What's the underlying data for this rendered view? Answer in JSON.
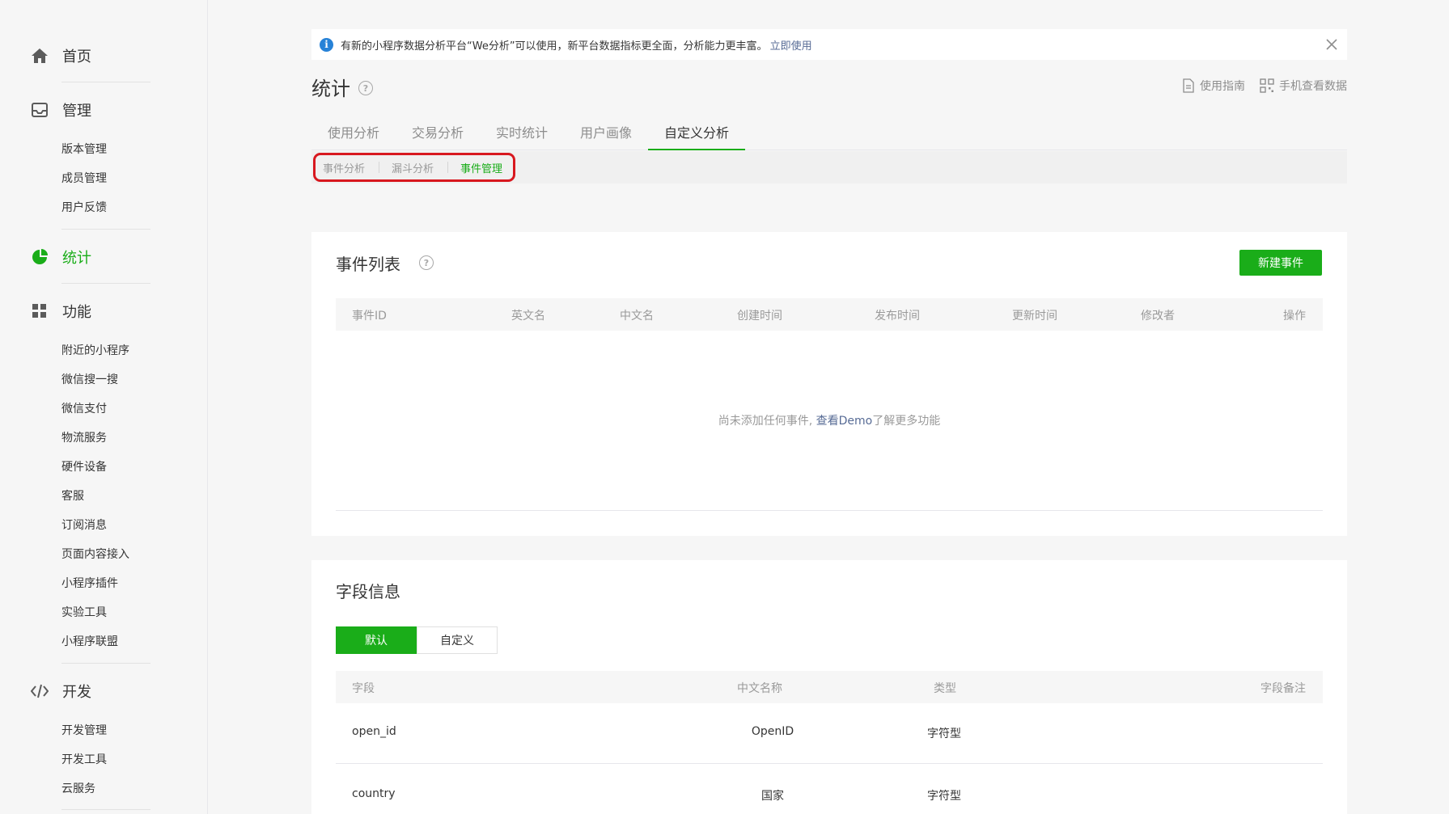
{
  "sidebar": {
    "home": "首页",
    "manage": "管理",
    "manage_items": [
      "版本管理",
      "成员管理",
      "用户反馈"
    ],
    "stats": "统计",
    "features": "功能",
    "feature_items": [
      "附近的小程序",
      "微信搜一搜",
      "微信支付",
      "物流服务",
      "硬件设备",
      "客服",
      "订阅消息",
      "页面内容接入",
      "小程序插件",
      "实验工具",
      "小程序联盟"
    ],
    "dev": "开发",
    "dev_items": [
      "开发管理",
      "开发工具",
      "云服务"
    ]
  },
  "notice": {
    "text": "有新的小程序数据分析平台“We分析”可以使用，新平台数据指标更全面，分析能力更丰富。",
    "link": "立即使用"
  },
  "header": {
    "title": "统计",
    "guide": "使用指南",
    "mobile": "手机查看数据"
  },
  "tabs": [
    "使用分析",
    "交易分析",
    "实时统计",
    "用户画像",
    "自定义分析"
  ],
  "subtabs": [
    "事件分析",
    "漏斗分析",
    "事件管理"
  ],
  "event_list": {
    "title": "事件列表",
    "new_button": "新建事件",
    "columns": [
      "事件ID",
      "英文名",
      "中文名",
      "创建时间",
      "发布时间",
      "更新时间",
      "修改者",
      "操作"
    ],
    "empty_prefix": "尚未添加任何事件,",
    "empty_link": "查看Demo",
    "empty_suffix": "了解更多功能"
  },
  "fields": {
    "title": "字段信息",
    "seg_default": "默认",
    "seg_custom": "自定义",
    "columns": [
      "字段",
      "中文名称",
      "类型",
      "字段备注"
    ],
    "rows": [
      {
        "field": "open_id",
        "name": "OpenID",
        "type": "字符型"
      },
      {
        "field": "country",
        "name": "国家",
        "type": "字符型"
      }
    ]
  }
}
